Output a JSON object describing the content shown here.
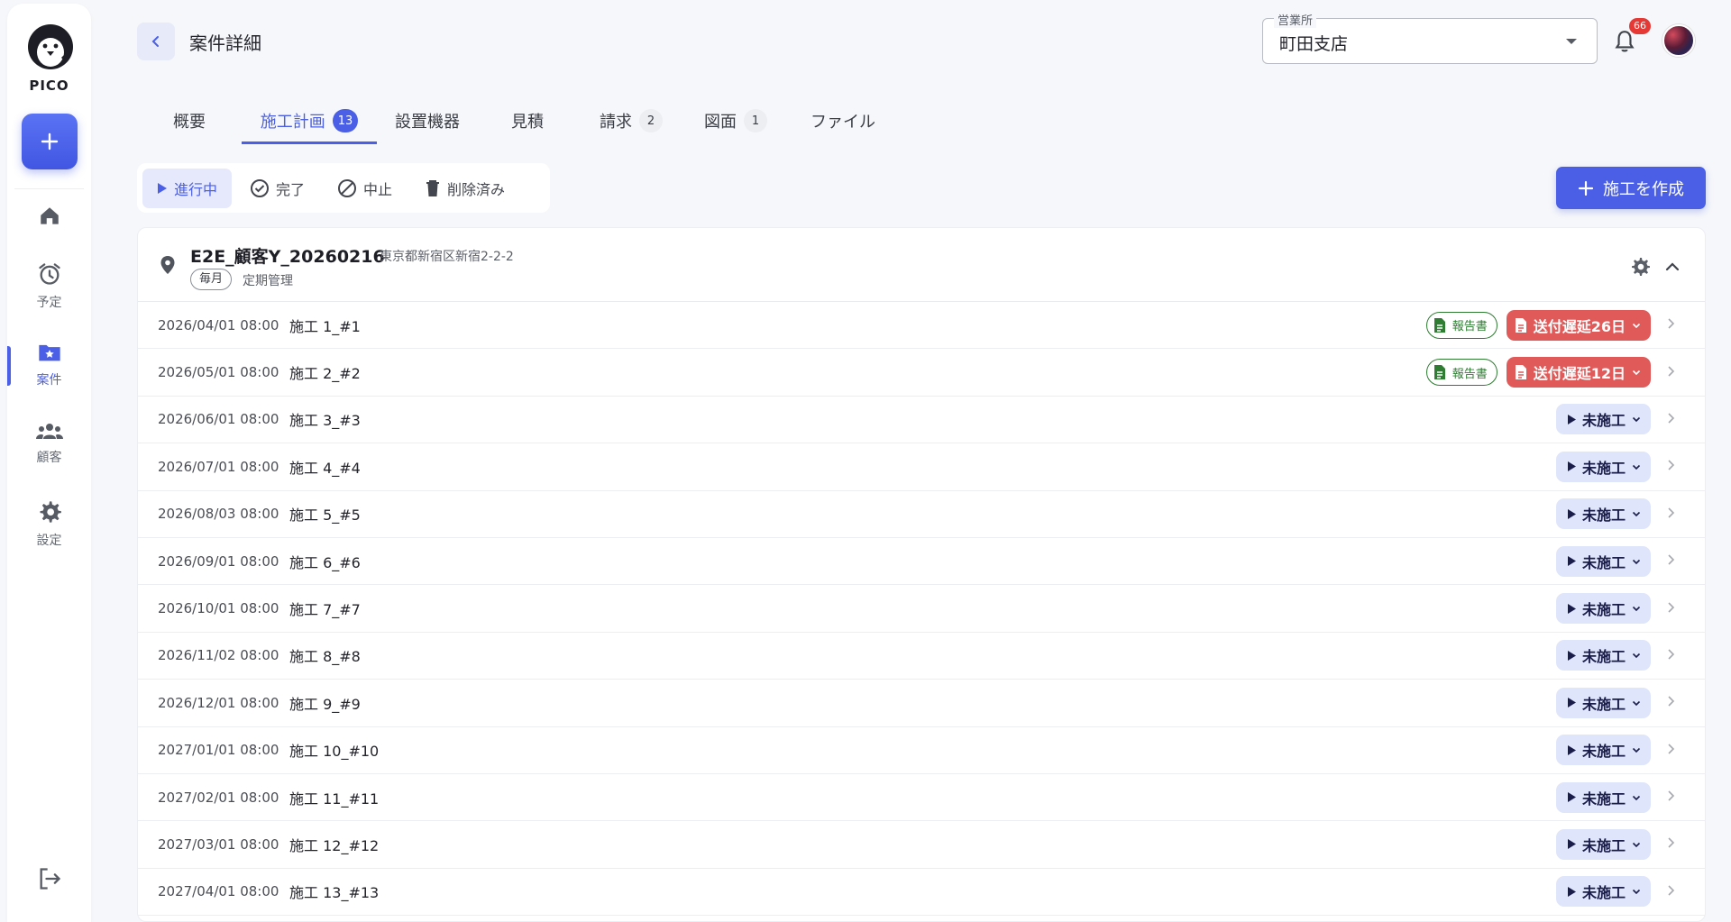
{
  "app": {
    "logo_text": "PICO"
  },
  "sidebar": {
    "items": [
      {
        "label": "",
        "icon": "home-icon"
      },
      {
        "label": "予定",
        "icon": "alarm-clock-icon"
      },
      {
        "label": "案件",
        "icon": "folder-star-icon",
        "active": true
      },
      {
        "label": "顧客",
        "icon": "people-icon"
      },
      {
        "label": "設定",
        "icon": "gear-icon"
      }
    ]
  },
  "header": {
    "title": "案件詳細",
    "office_label": "営業所",
    "office_value": "町田支店",
    "notification_count": "66"
  },
  "tabs": [
    {
      "label": "概要",
      "count": ""
    },
    {
      "label": "施工計画",
      "count": "13",
      "active": true
    },
    {
      "label": "設置機器",
      "count": ""
    },
    {
      "label": "見積",
      "count": ""
    },
    {
      "label": "請求",
      "count": "2"
    },
    {
      "label": "図面",
      "count": "1"
    },
    {
      "label": "ファイル",
      "count": ""
    }
  ],
  "filters": [
    {
      "label": "進行中",
      "icon": "play-icon",
      "active": true
    },
    {
      "label": "完了",
      "icon": "check-circle-icon"
    },
    {
      "label": "中止",
      "icon": "block-icon"
    },
    {
      "label": "削除済み",
      "icon": "trash-icon"
    }
  ],
  "create_button": "施工を作成",
  "site": {
    "name": "E2E_顧客Y_20260216",
    "address": "東京都新宿区新宿2-2-2",
    "frequency": "毎月",
    "kind": "定期管理"
  },
  "report_label": "報告書",
  "rows": [
    {
      "datetime": "2026/04/01 08:00",
      "name": "施工 1_#1",
      "report": true,
      "status": "送付遅延26日",
      "status_type": "late"
    },
    {
      "datetime": "2026/05/01 08:00",
      "name": "施工 2_#2",
      "report": true,
      "status": "送付遅延12日",
      "status_type": "late"
    },
    {
      "datetime": "2026/06/01 08:00",
      "name": "施工 3_#3",
      "report": false,
      "status": "未施工",
      "status_type": "todo"
    },
    {
      "datetime": "2026/07/01 08:00",
      "name": "施工 4_#4",
      "report": false,
      "status": "未施工",
      "status_type": "todo"
    },
    {
      "datetime": "2026/08/03 08:00",
      "name": "施工 5_#5",
      "report": false,
      "status": "未施工",
      "status_type": "todo"
    },
    {
      "datetime": "2026/09/01 08:00",
      "name": "施工 6_#6",
      "report": false,
      "status": "未施工",
      "status_type": "todo"
    },
    {
      "datetime": "2026/10/01 08:00",
      "name": "施工 7_#7",
      "report": false,
      "status": "未施工",
      "status_type": "todo"
    },
    {
      "datetime": "2026/11/02 08:00",
      "name": "施工 8_#8",
      "report": false,
      "status": "未施工",
      "status_type": "todo"
    },
    {
      "datetime": "2026/12/01 08:00",
      "name": "施工 9_#9",
      "report": false,
      "status": "未施工",
      "status_type": "todo"
    },
    {
      "datetime": "2027/01/01 08:00",
      "name": "施工 10_#10",
      "report": false,
      "status": "未施工",
      "status_type": "todo"
    },
    {
      "datetime": "2027/02/01 08:00",
      "name": "施工 11_#11",
      "report": false,
      "status": "未施工",
      "status_type": "todo"
    },
    {
      "datetime": "2027/03/01 08:00",
      "name": "施工 12_#12",
      "report": false,
      "status": "未施工",
      "status_type": "todo"
    },
    {
      "datetime": "2027/04/01 08:00",
      "name": "施工 13_#13",
      "report": false,
      "status": "未施工",
      "status_type": "todo"
    }
  ],
  "colors": {
    "accent": "#4a5fe6",
    "late": "#e05a5a",
    "todo_bg": "#dfe5fb",
    "report": "#2e7d32"
  }
}
